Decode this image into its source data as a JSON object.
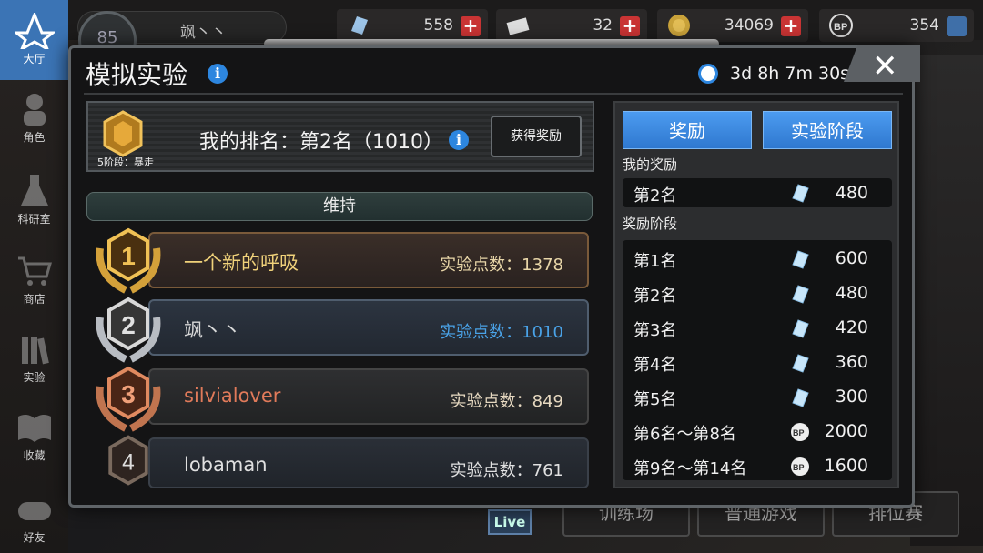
{
  "sidebar": {
    "items": [
      {
        "label": "大厅",
        "icon": "lobby-icon"
      },
      {
        "label": "角色",
        "icon": "character-icon"
      },
      {
        "label": "科研室",
        "icon": "flask-icon"
      },
      {
        "label": "商店",
        "icon": "cart-icon"
      },
      {
        "label": "实验",
        "icon": "books-icon"
      },
      {
        "label": "收藏",
        "icon": "book-icon"
      },
      {
        "label": "好友",
        "icon": "gamepad-icon"
      }
    ]
  },
  "topbar": {
    "level": "85",
    "player_name": "飒丶丶",
    "resources": [
      {
        "value": "558",
        "icon": "diamond-icon"
      },
      {
        "value": "32",
        "icon": "ticket-icon"
      },
      {
        "value": "34069",
        "icon": "coin-icon"
      },
      {
        "value": "354",
        "icon": "bp-icon"
      }
    ]
  },
  "background": {
    "bottom_buttons": [
      "训练场",
      "普通游戏",
      "排位赛"
    ],
    "live_label": "Live"
  },
  "modal": {
    "title": "模拟实验",
    "timer": "3d 8h 7m 30s",
    "close_symbol": "✕",
    "badge_caption": "5阶段：暴走",
    "my_rank": "我的排名：第2名（1010）",
    "get_reward_label": "获得奖励",
    "status": "维持",
    "rankings": [
      {
        "rank": "1",
        "name": "一个新的呼吸",
        "points": "实验点数：1378"
      },
      {
        "rank": "2",
        "name": "飒丶丶",
        "points": "实验点数：1010"
      },
      {
        "rank": "3",
        "name": "silvialover",
        "points": "实验点数：849"
      },
      {
        "rank": "4",
        "name": "lobaman",
        "points": "实验点数：761"
      }
    ],
    "right_panel": {
      "tabs": [
        "奖励",
        "实验阶段"
      ],
      "my_reward_label": "我的奖励",
      "my_reward": {
        "name": "第2名",
        "value": "480",
        "icon": "diamond-icon"
      },
      "reward_stage_label": "奖励阶段",
      "rewards": [
        {
          "name": "第1名",
          "value": "600",
          "icon": "diamond-icon"
        },
        {
          "name": "第2名",
          "value": "480",
          "icon": "diamond-icon"
        },
        {
          "name": "第3名",
          "value": "420",
          "icon": "diamond-icon"
        },
        {
          "name": "第4名",
          "value": "360",
          "icon": "diamond-icon"
        },
        {
          "name": "第5名",
          "value": "300",
          "icon": "diamond-icon"
        },
        {
          "name": "第6名～第8名",
          "value": "2000",
          "icon": "bp-icon"
        },
        {
          "name": "第9名～第14名",
          "value": "1600",
          "icon": "bp-icon"
        }
      ]
    }
  },
  "colors": {
    "accent_blue": "#2d86df",
    "gold": "#d4a13a",
    "silver": "#b8bcc2",
    "bronze": "#c0744f",
    "points_highlight": "#4aa3e8"
  }
}
